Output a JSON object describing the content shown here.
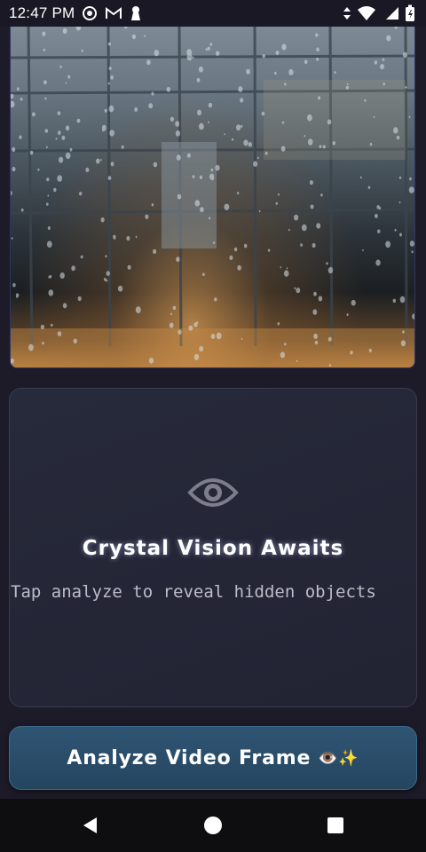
{
  "status_bar": {
    "time": "12:47 PM",
    "left_icons": [
      "camera-app-icon",
      "gmail-icon",
      "keyhole-icon"
    ],
    "right_icons": [
      "data-transfer-icon",
      "wifi-icon",
      "signal-icon",
      "battery-icon"
    ]
  },
  "video_preview": {
    "description_icon": "video-frame"
  },
  "analysis_card": {
    "icon": "eye-icon",
    "title": "Crystal Vision Awaits",
    "subtitle": "Tap analyze to reveal hidden objects"
  },
  "analyze_button": {
    "label": "Analyze Video Frame",
    "emoji": "👁️✨"
  },
  "nav_bar": {
    "buttons": [
      "back",
      "home",
      "recents"
    ]
  },
  "colors": {
    "background": "#1d1b28",
    "card": "#262838",
    "button": "#2b4d6a",
    "text_muted": "#bdbcc8"
  }
}
